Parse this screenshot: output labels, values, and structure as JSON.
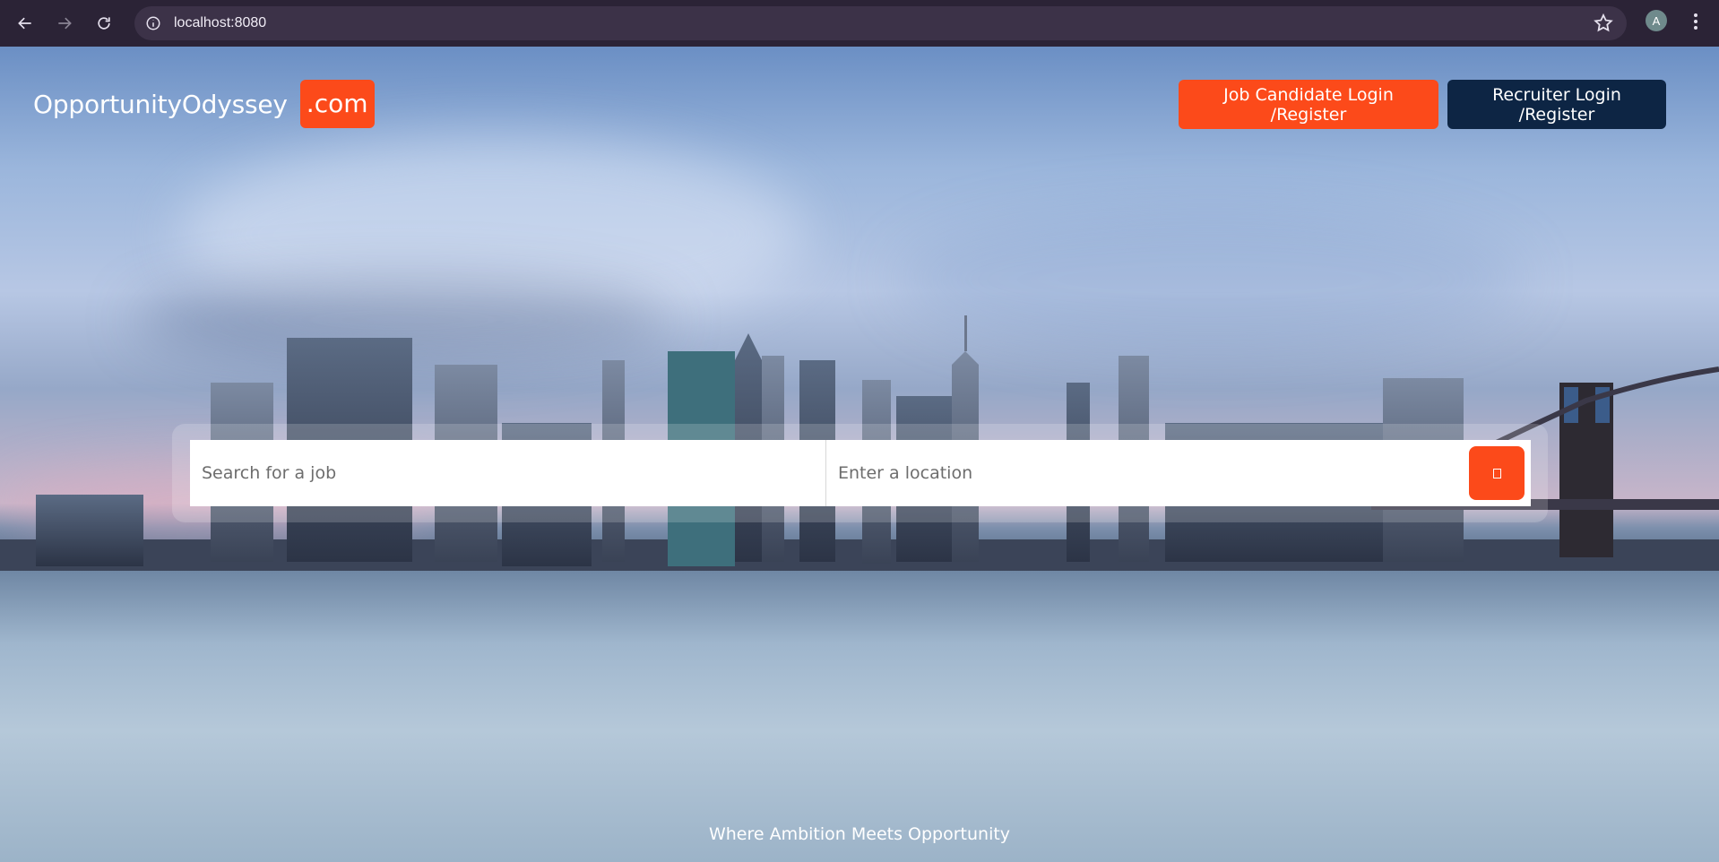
{
  "browser": {
    "url": "localhost:8080",
    "avatar_letter": "A"
  },
  "brand": {
    "name": "OpportunityOdyssey",
    "tld": ".com",
    "accent_color": "#fc4a1a",
    "navy_color": "#0d2544"
  },
  "header": {
    "candidate_button": "Job Candidate Login /Register",
    "recruiter_button": "Recruiter Login /Register"
  },
  "search": {
    "job_placeholder": "Search for a job",
    "location_placeholder": "Enter a location",
    "submit_icon": "search-icon"
  },
  "footer": {
    "tagline": "Where Ambition Meets Opportunity"
  },
  "background": "city-skyline-waterfront-photo"
}
